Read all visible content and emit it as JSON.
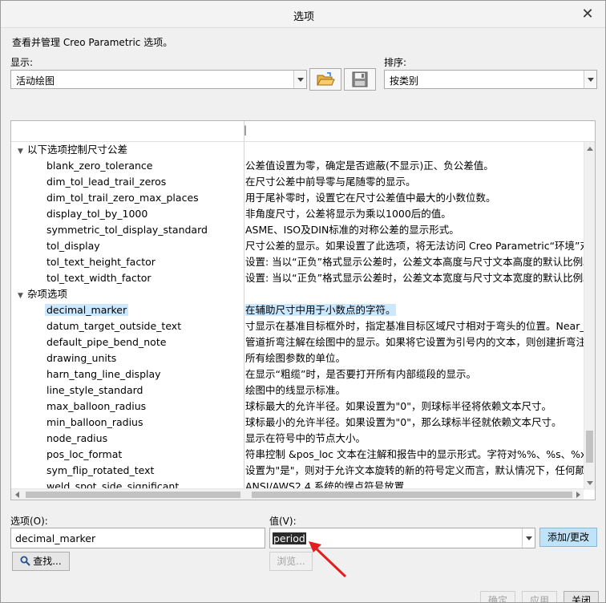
{
  "window": {
    "title": "选项"
  },
  "intro": "查看并管理 Creo Parametric 选项。",
  "display": {
    "label": "显示:",
    "value": "活动绘图"
  },
  "sort": {
    "label": "排序:",
    "value": "按类别"
  },
  "table": {
    "header_stub": "|",
    "groups": [
      {
        "label": "以下选项控制尺寸公差"
      },
      {
        "label": "杂项选项"
      }
    ],
    "rows": [
      {
        "group": 0,
        "name": "blank_zero_tolerance",
        "desc": "公差值设置为零，确定是否遮蔽(不显示)正、负公差值。"
      },
      {
        "group": 0,
        "name": "dim_tol_lead_trail_zeros",
        "desc": "在尺寸公差中前导零与尾随零的显示。"
      },
      {
        "group": 0,
        "name": "dim_tol_trail_zero_max_places",
        "desc": "用于尾补零时，设置它在尺寸公差值中最大的小数位数。"
      },
      {
        "group": 0,
        "name": "display_tol_by_1000",
        "desc": "非角度尺寸，公差将显示为乘以1000后的值。"
      },
      {
        "group": 0,
        "name": "symmetric_tol_display_standard",
        "desc": "ASME、ISO及DIN标准的对称公差的显示形式。"
      },
      {
        "group": 0,
        "name": "tol_display",
        "desc": "尺寸公差的显示。如果设置了此选项，将无法访问 Creo Parametric“环境”对话框"
      },
      {
        "group": 0,
        "name": "tol_text_height_factor",
        "desc": "设置: 当以“正负”格式显示公差时，公差文本高度与尺寸文本高度的默认比例。对"
      },
      {
        "group": 0,
        "name": "tol_text_width_factor",
        "desc": "设置: 当以“正负”格式显示公差时，公差文本宽度与尺寸文本宽度的默认比例。对"
      },
      {
        "group": 1,
        "name": "decimal_marker",
        "desc": "在辅助尺寸中用于小数点的字符。",
        "selected": true
      },
      {
        "group": 1,
        "name": "datum_target_outside_text",
        "desc": "寸显示在基准目标框外时，指定基准目标区域尺寸相对于弯头的位置。Near_elbo"
      },
      {
        "group": 1,
        "name": "default_pipe_bend_note",
        "desc": "管道折弯注解在绘图中的显示。如果将它设置为引号内的文本，则创建折弯注解时"
      },
      {
        "group": 1,
        "name": "drawing_units",
        "desc": "所有绘图参数的单位。"
      },
      {
        "group": 1,
        "name": "harn_tang_line_display",
        "desc": "在显示“粗缆”时，是否要打开所有内部缆段的显示。"
      },
      {
        "group": 1,
        "name": "line_style_standard",
        "desc": "绘图中的线显示标准。"
      },
      {
        "group": 1,
        "name": "max_balloon_radius",
        "desc": "球标最大的允许半径。如果设置为\"0\"，则球标半径将依赖文本尺寸。"
      },
      {
        "group": 1,
        "name": "min_balloon_radius",
        "desc": "球标最小的允许半径。如果设置为\"0\"，那么球标半径就依赖文本尺寸。"
      },
      {
        "group": 1,
        "name": "node_radius",
        "desc": "显示在符号中的节点大小。"
      },
      {
        "group": 1,
        "name": "pos_loc_format",
        "desc": "符串控制 &pos_loc 文本在注解和报告中的显示形式。字符对%%、%s、%x、%"
      },
      {
        "group": 1,
        "name": "sym_flip_rotated_text",
        "desc": "设置为\"是\"，则对于允许文本旋转的新的符号定义而言，默认情况下，任何颠倒"
      },
      {
        "group": 1,
        "name": "weld_spot_side_significant",
        "desc": "ANSI/AWS2.4 系统的焊点符号放置"
      }
    ]
  },
  "option": {
    "label": "选项(O):",
    "value": "decimal_marker"
  },
  "value": {
    "label": "值(V):",
    "value": "period"
  },
  "buttons": {
    "add_change": "添加/更改",
    "find": "查找...",
    "browse": "浏览...",
    "ok": "确定",
    "apply": "应用",
    "close": "关闭"
  },
  "colors": {
    "selection": "#cce8ff",
    "add_button": "#bfe3f9",
    "annotation_arrow": "#e02020"
  },
  "icons": [
    "close-icon",
    "open-folder-icon",
    "save-icon",
    "search-icon",
    "expand-triangle-icon"
  ]
}
